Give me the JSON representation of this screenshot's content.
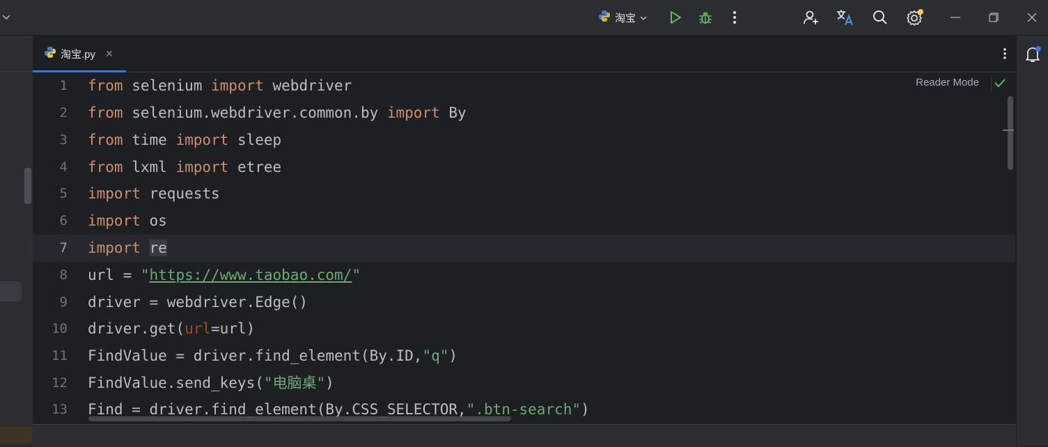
{
  "titlebar": {
    "run_config_label": "淘宝",
    "icons": [
      "chevron-down-icon",
      "python-icon",
      "run-icon",
      "debug-icon",
      "more-vertical-icon",
      "add-user-icon",
      "translate-icon",
      "search-icon",
      "settings-icon",
      "minimize-icon",
      "restore-icon",
      "close-icon"
    ]
  },
  "tabs": [
    {
      "label": "淘宝.py",
      "active": true
    }
  ],
  "editor": {
    "reader_mode_label": "Reader Mode",
    "current_line": 7,
    "line_numbers": [
      "1",
      "2",
      "3",
      "4",
      "5",
      "6",
      "7",
      "8",
      "9",
      "10",
      "11",
      "12",
      "13"
    ]
  },
  "code_tokens": {
    "l1": [
      "from",
      " selenium ",
      "import",
      " webdriver"
    ],
    "l2": [
      "from",
      " selenium.webdriver.common.by ",
      "import",
      " By"
    ],
    "l3": [
      "from",
      " time ",
      "import",
      " sleep"
    ],
    "l4": [
      "from",
      " lxml ",
      "import",
      " etree"
    ],
    "l5": [
      "import",
      " requests"
    ],
    "l6": [
      "import",
      " os"
    ],
    "l7": [
      "import",
      " ",
      "re"
    ],
    "l8": [
      "url = ",
      "\"",
      "https://www.taobao.com/",
      "\""
    ],
    "l9": [
      "driver = webdriver.Edge()"
    ],
    "l10": [
      "driver.get(",
      "url",
      "=url)"
    ],
    "l11": [
      "FindValue = driver.find_element(By.ID,",
      "\"q\"",
      ")"
    ],
    "l12": [
      "FindValue.send_keys(",
      "\"电脑桌\"",
      ")"
    ],
    "l13": [
      "Find = driver.find_element(By.CSS_SELECTOR,",
      "\".btn-search\"",
      ")"
    ]
  },
  "colors": {
    "keyword": "#cf8e6d",
    "string": "#6aab73",
    "param": "#aa4926",
    "accent": "#3574f0",
    "notification_dot": "#f2c55c"
  }
}
